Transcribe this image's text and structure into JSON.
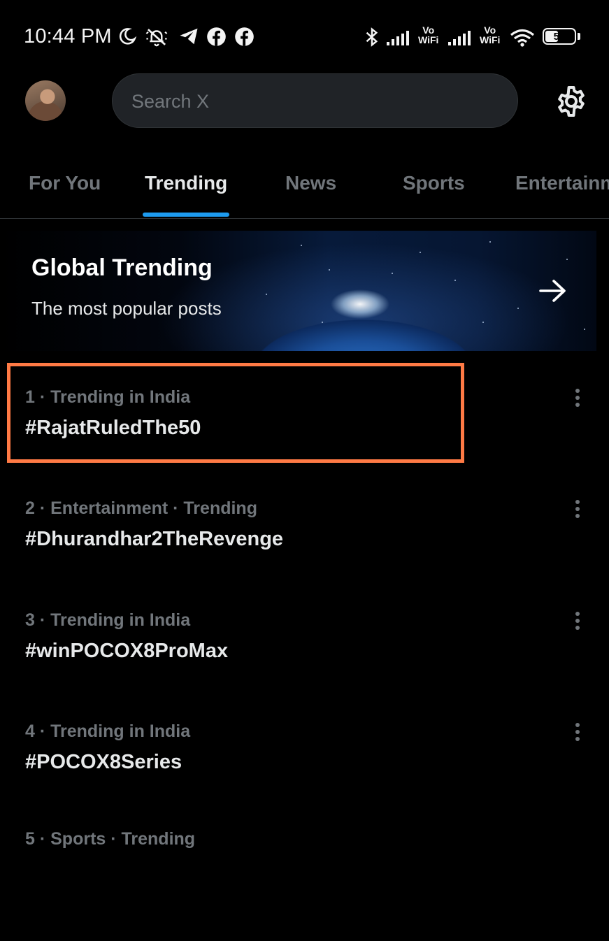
{
  "status_bar": {
    "time": "10:44 PM",
    "vowifi_1_top": "Vo",
    "vowifi_1_bottom": "WiFi",
    "vowifi_2_top": "Vo",
    "vowifi_2_bottom": "WiFi",
    "battery_percent": "51",
    "battery_level": 0.51,
    "icons": [
      "moon-icon",
      "notifications-off-icon",
      "telegram-icon",
      "facebook-icon",
      "facebook-icon",
      "bluetooth-icon",
      "signal-icon",
      "signal-icon",
      "wifi-icon",
      "battery-icon"
    ]
  },
  "header": {
    "search_placeholder": "Search X",
    "settings_icon": "gear-icon"
  },
  "tabs": [
    {
      "label": "For You",
      "active": false
    },
    {
      "label": "Trending",
      "active": true
    },
    {
      "label": "News",
      "active": false
    },
    {
      "label": "Sports",
      "active": false
    },
    {
      "label": "Entertainm",
      "active": false
    }
  ],
  "banner": {
    "title": "Global Trending",
    "subtitle": "The most popular posts"
  },
  "trends": [
    {
      "meta": "1 · Trending in India",
      "tag": "#RajatRuledThe50"
    },
    {
      "meta": "2 · Entertainment · Trending",
      "tag": "#Dhurandhar2TheRevenge"
    },
    {
      "meta": "3 · Trending in India",
      "tag": "#winPOCOX8ProMax"
    },
    {
      "meta": "4 · Trending in India",
      "tag": "#POCOX8Series"
    },
    {
      "meta": "5 · Sports · Trending",
      "tag": ""
    }
  ],
  "colors": {
    "accent": "#1d9bf0",
    "highlight_border": "#ff7a45",
    "muted_text": "#71767b"
  }
}
